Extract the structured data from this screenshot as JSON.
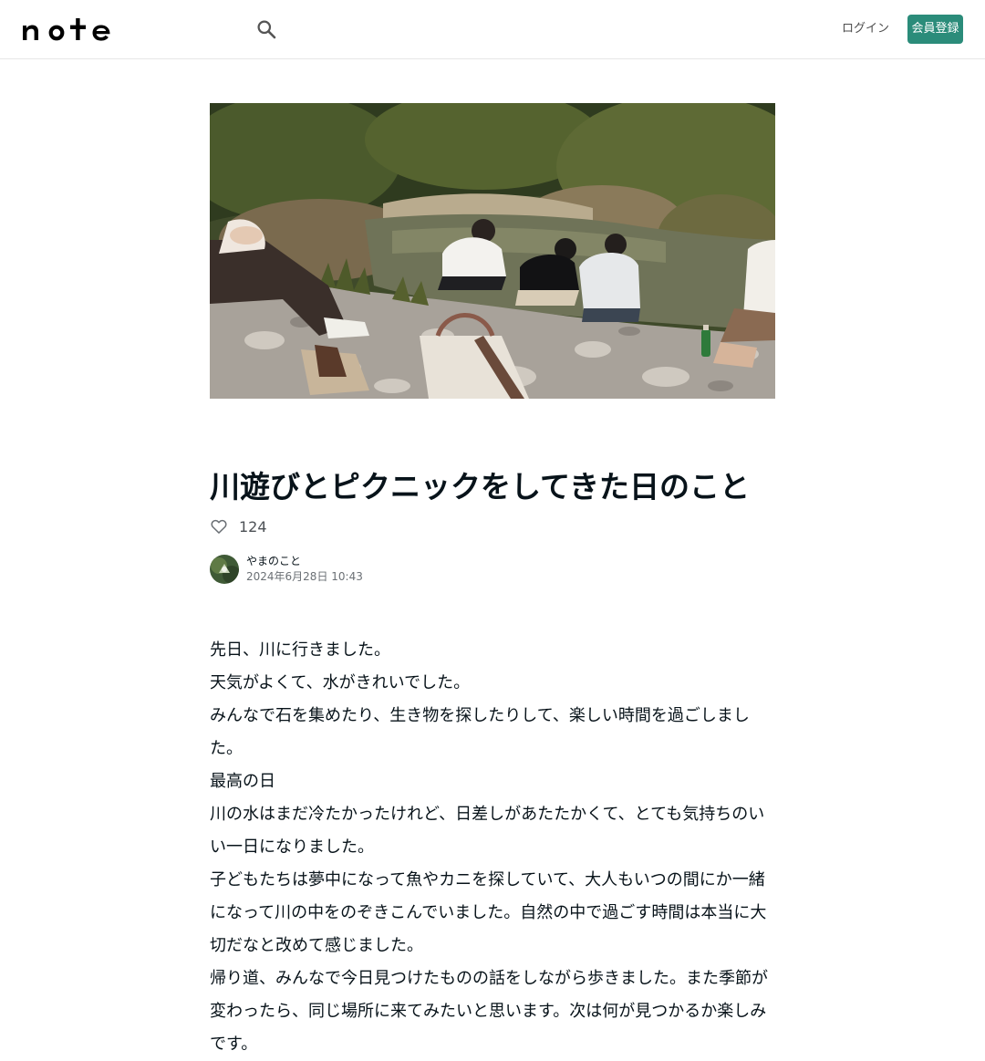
{
  "header": {
    "logo_text": "note",
    "login_label": "ログイン",
    "signup_label": "会員登録",
    "brand_color": "#2b8c7a"
  },
  "article": {
    "hero_image": "river-picnic-photo",
    "title": "川遊びとピクニックをしてきた日のこと",
    "like_count": "124",
    "author": {
      "name": "やまのこと",
      "date": "2024年6月28日 10:43"
    },
    "paragraphs": [
      "先日、川に行きました。",
      "天気がよくて、水がきれいでした。",
      "みんなで石を集めたり、生き物を探したりして、楽しい時間を過ごしました。",
      "最高の日",
      "川の水はまだ冷たかったけれど、日差しがあたたかくて、とても気持ちのいい一日になりました。",
      "子どもたちは夢中になって魚やカニを探していて、大人もいつの間にか一緒になって川の中をのぞきこんでいました。自然の中で過ごす時間は本当に大切だなと改めて感じました。",
      "帰り道、みんなで今日見つけたものの話をしながら歩きました。また季節が変わったら、同じ場所に来てみたいと思います。次は何が見つかるか楽しみです。"
    ]
  }
}
